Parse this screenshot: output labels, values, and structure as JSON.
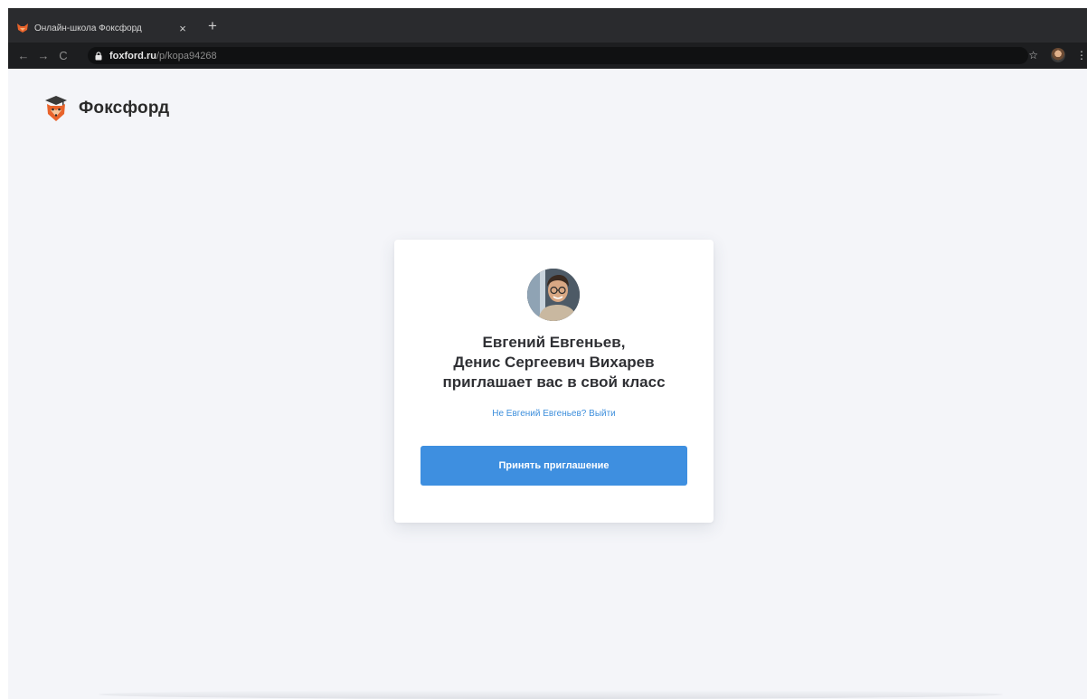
{
  "browser": {
    "tab": {
      "title": "Онлайн-школа Фоксфорд",
      "close_glyph": "×",
      "favicon": "foxford-favicon"
    },
    "new_tab_glyph": "+",
    "nav": {
      "back_glyph": "←",
      "forward_glyph": "→",
      "reload_glyph": "C"
    },
    "address": {
      "host": "foxford.ru",
      "path": "/p/kopa94268"
    },
    "toolbar_right": {
      "star_glyph": "☆",
      "menu_glyph": "⋮"
    },
    "colors": {
      "tabstrip": "#2a2b2e",
      "toolbar": "#1d1e20",
      "omnibox": "#101112"
    }
  },
  "page": {
    "logo": {
      "text": "Фоксфорд",
      "icon": "fox-logo-icon"
    },
    "card": {
      "invite_lines": [
        "Евгений Евгеньев,",
        "Денис Сергеевич Вихарев",
        "приглашает вас в свой класс"
      ],
      "logout_link": "Не Евгений Евгеньев? Выйти",
      "accept_button": "Принять приглашение"
    },
    "colors": {
      "background": "#f4f5f9",
      "accent": "#3e8fe0",
      "link": "#3e8fdc",
      "heading": "#2f3034"
    }
  }
}
